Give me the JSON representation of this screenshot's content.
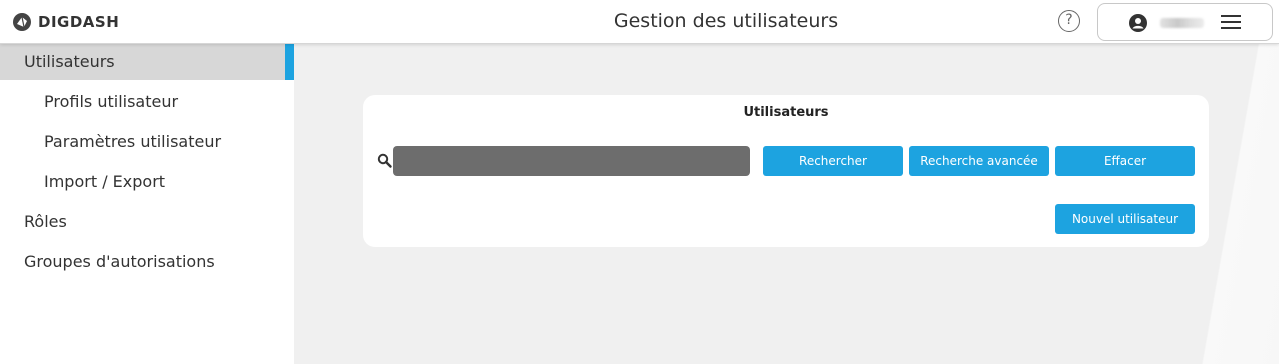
{
  "header": {
    "logo_text": "DIGDASH",
    "title": "Gestion des utilisateurs",
    "help_label": "?",
    "user_menu": {
      "username": ""
    }
  },
  "sidebar": {
    "items": [
      {
        "label": "Utilisateurs",
        "active": true
      },
      {
        "label": "Profils utilisateur",
        "active": false
      },
      {
        "label": "Paramètres utilisateur",
        "active": false
      },
      {
        "label": "Import / Export",
        "active": false
      },
      {
        "label": "Rôles",
        "active": false
      },
      {
        "label": "Groupes d'autorisations",
        "active": false
      }
    ]
  },
  "main": {
    "card_title": "Utilisateurs",
    "search": {
      "value": "",
      "placeholder": ""
    },
    "buttons": {
      "search": "Rechercher",
      "advanced_search": "Recherche avancée",
      "clear": "Effacer",
      "new_user": "Nouvel utilisateur"
    }
  },
  "colors": {
    "accent": "#1da3e0",
    "active_nav_bg": "#d7d7d7",
    "search_field_bg": "#6d6d6d",
    "page_bg": "#f0f0f0"
  },
  "icons": [
    "digdash-logo-icon",
    "help-icon",
    "user-avatar-icon",
    "hamburger-menu-icon",
    "search-icon"
  ]
}
